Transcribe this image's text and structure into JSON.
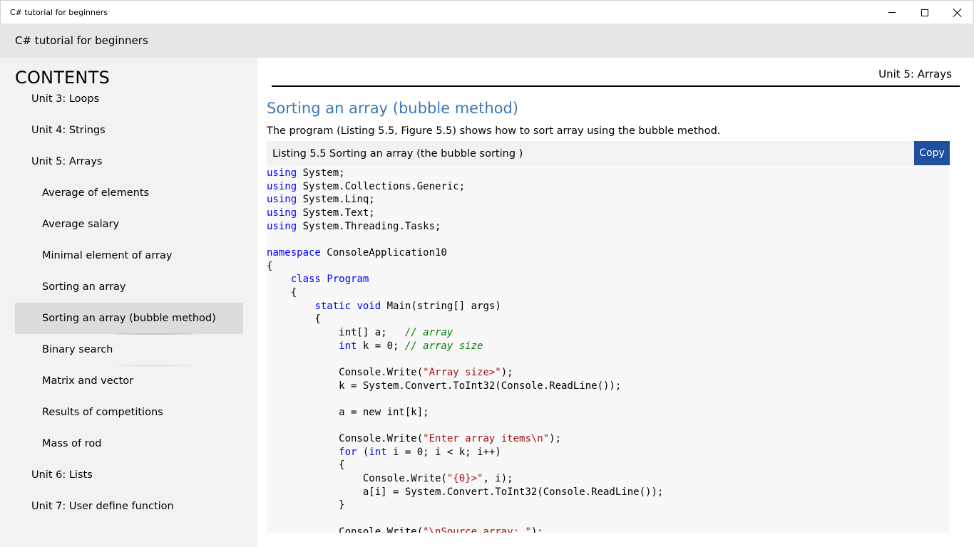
{
  "window": {
    "title": "C# tutorial for beginners"
  },
  "app": {
    "header_title": "C# tutorial for beginners"
  },
  "sidebar": {
    "heading": "CONTENTS",
    "items": [
      {
        "label": "Unit 3: Loops",
        "level": 1
      },
      {
        "label": "Unit 4: Strings",
        "level": 1
      },
      {
        "label": "Unit 5: Arrays",
        "level": 1
      },
      {
        "label": "Average of elements",
        "level": 2
      },
      {
        "label": "Average salary",
        "level": 2
      },
      {
        "label": "Minimal element of array",
        "level": 2
      },
      {
        "label": "Sorting an array",
        "level": 2
      },
      {
        "label": "Sorting an array (bubble method)",
        "level": 2,
        "selected": true
      },
      {
        "label": "Binary search",
        "level": 2
      },
      {
        "label": "Matrix and vector",
        "level": 2
      },
      {
        "label": "Results of competitions",
        "level": 2
      },
      {
        "label": "Mass of rod",
        "level": 2
      },
      {
        "label": "Unit 6: Lists",
        "level": 1
      },
      {
        "label": "Unit 7: User define function",
        "level": 1
      }
    ]
  },
  "main": {
    "unit_label": "Unit 5: Arrays",
    "section_title": "Sorting an array (bubble method)",
    "intro": "The program (Listing 5.5, Figure 5.5) shows how to sort array using the bubble method.",
    "listing_caption": "Listing 5.5 Sorting an array (the bubble sorting )",
    "copy_label": "Copy",
    "code_lines": [
      [
        [
          "kw",
          "using"
        ],
        [
          "t",
          " System;"
        ]
      ],
      [
        [
          "kw",
          "using"
        ],
        [
          "t",
          " System.Collections.Generic;"
        ]
      ],
      [
        [
          "kw",
          "using"
        ],
        [
          "t",
          " System.Linq;"
        ]
      ],
      [
        [
          "kw",
          "using"
        ],
        [
          "t",
          " System.Text;"
        ]
      ],
      [
        [
          "kw",
          "using"
        ],
        [
          "t",
          " System.Threading.Tasks;"
        ]
      ],
      [],
      [
        [
          "kw",
          "namespace"
        ],
        [
          "t",
          " ConsoleApplication10"
        ]
      ],
      [
        [
          "t",
          "{"
        ]
      ],
      [
        [
          "t",
          "    "
        ],
        [
          "kw",
          "class"
        ],
        [
          "t",
          " "
        ],
        [
          "kw",
          "Program"
        ]
      ],
      [
        [
          "t",
          "    {"
        ]
      ],
      [
        [
          "t",
          "        "
        ],
        [
          "kw",
          "static"
        ],
        [
          "t",
          " "
        ],
        [
          "kw",
          "void"
        ],
        [
          "t",
          " Main(string[] args)"
        ]
      ],
      [
        [
          "t",
          "        {"
        ]
      ],
      [
        [
          "t",
          "            int[] a;   "
        ],
        [
          "cm",
          "// array"
        ]
      ],
      [
        [
          "t",
          "            "
        ],
        [
          "kw",
          "int"
        ],
        [
          "t",
          " k = 0; "
        ],
        [
          "cm",
          "// array size"
        ]
      ],
      [],
      [
        [
          "t",
          "            Console.Write("
        ],
        [
          "str",
          "\"Array size>\""
        ],
        [
          "t",
          ");"
        ]
      ],
      [
        [
          "t",
          "            k = System.Convert.ToInt32(Console.ReadLine());"
        ]
      ],
      [],
      [
        [
          "t",
          "            a = new int[k];"
        ]
      ],
      [],
      [
        [
          "t",
          "            Console.Write("
        ],
        [
          "str",
          "\"Enter array items\\n\""
        ],
        [
          "t",
          ");"
        ]
      ],
      [
        [
          "t",
          "            "
        ],
        [
          "kw",
          "for"
        ],
        [
          "t",
          " ("
        ],
        [
          "kw",
          "int"
        ],
        [
          "t",
          " i = 0; i < k; i++)"
        ]
      ],
      [
        [
          "t",
          "            {"
        ]
      ],
      [
        [
          "t",
          "                Console.Write("
        ],
        [
          "str",
          "\"{0}>\""
        ],
        [
          "t",
          ", i);"
        ]
      ],
      [
        [
          "t",
          "                a[i] = System.Convert.ToInt32(Console.ReadLine());"
        ]
      ],
      [
        [
          "t",
          "            }"
        ]
      ],
      [],
      [
        [
          "t",
          "            Console.Write("
        ],
        [
          "str",
          "\"\\nSource array: \""
        ],
        [
          "t",
          ");"
        ]
      ]
    ]
  }
}
